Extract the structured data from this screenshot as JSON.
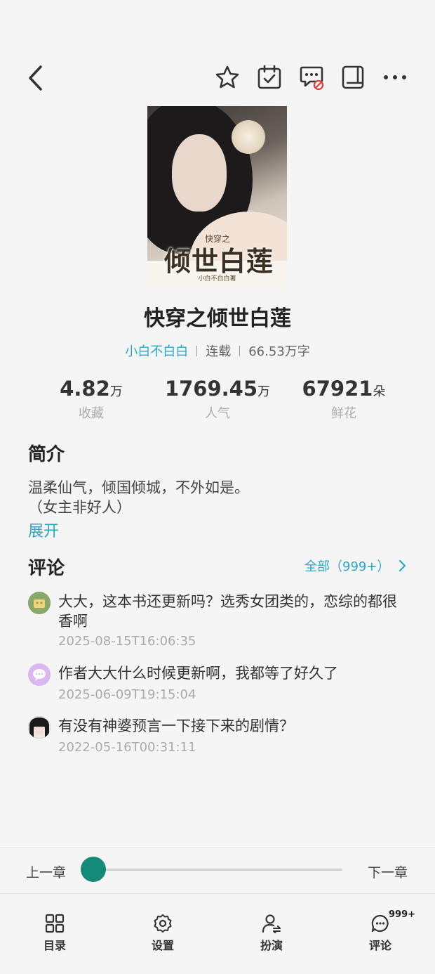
{
  "topbar": {
    "icons": [
      "back-icon",
      "star-icon",
      "calendar-check-icon",
      "comment-blocked-icon",
      "book-icon",
      "more-icon"
    ]
  },
  "book": {
    "cover": {
      "series": "快穿之",
      "title": "倾世白莲",
      "author": "小白不白白著"
    },
    "title": "快穿之倾世白莲",
    "author": "小白不白白",
    "status": "连载",
    "word_count": "66.53万字"
  },
  "stats": [
    {
      "value": "4.82",
      "unit": "万",
      "label": "收藏"
    },
    {
      "value": "1769.45",
      "unit": "万",
      "label": "人气"
    },
    {
      "value": "67921",
      "unit": "朵",
      "label": "鲜花"
    }
  ],
  "intro": {
    "heading": "简介",
    "line1": "温柔仙气，倾国倾城，不外如是。",
    "line2": "（女主非好人）",
    "expand": "展开"
  },
  "comments": {
    "heading": "评论",
    "all_link": "全部（999+）",
    "items": [
      {
        "text": "大大，这本书还更新吗？选秀女团类的，恋综的都很香啊",
        "time": "2025-08-15T16:06:35",
        "avatar_color": "#8aa86a"
      },
      {
        "text": "作者大大什么时候更新啊，我都等了好久了",
        "time": "2025-06-09T19:15:04",
        "avatar_color": "#d9b8f0"
      },
      {
        "text": "有没有神婆预言一下接下来的剧情？",
        "time": "2022-05-16T00:31:11",
        "avatar_color": "#222222"
      }
    ]
  },
  "chapter_nav": {
    "prev": "上一章",
    "next": "下一章",
    "progress": 0
  },
  "bottom_tabs": [
    {
      "label": "目录",
      "icon": "grid-icon"
    },
    {
      "label": "设置",
      "icon": "gear-icon"
    },
    {
      "label": "扮演",
      "icon": "person-swap-icon"
    },
    {
      "label": "评论",
      "icon": "chat-icon",
      "badge": "999+"
    }
  ],
  "colors": {
    "accent": "#2aa6c8",
    "slider": "#168a78",
    "background": "#f5f5f5"
  }
}
